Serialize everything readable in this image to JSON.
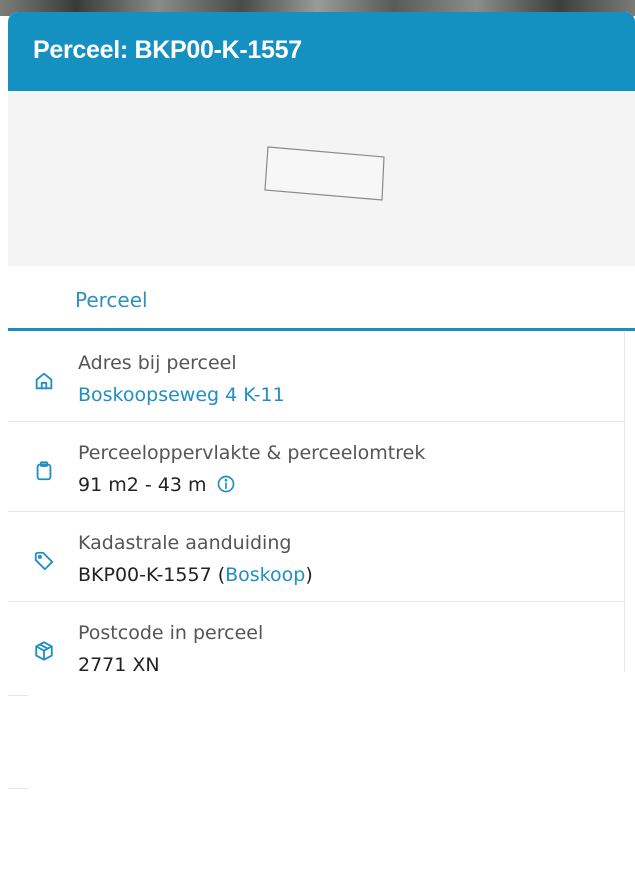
{
  "header": {
    "title": "Perceel: BKP00-K-1557"
  },
  "tabs": [
    {
      "label": "Perceel",
      "active": true
    }
  ],
  "items": [
    {
      "icon": "home-icon",
      "label": "Adres bij perceel",
      "value": "Boskoopseweg 4 K-11"
    },
    {
      "icon": "clipboard-icon",
      "label": "Perceeloppervlakte & perceelomtrek",
      "value": "91 m2 - 43 m"
    },
    {
      "icon": "tag-icon",
      "label": "Kadastrale aanduiding",
      "value_prefix": "BKP00-K-1557 (",
      "value_link": "Boskoop",
      "value_suffix": ")"
    },
    {
      "icon": "package-icon",
      "label": "Postcode in perceel",
      "value": "2771 XN"
    }
  ],
  "colors": {
    "header_bg": "#1591c1",
    "accent": "#1f8fc4",
    "map_bg": "#f4f4f4"
  }
}
